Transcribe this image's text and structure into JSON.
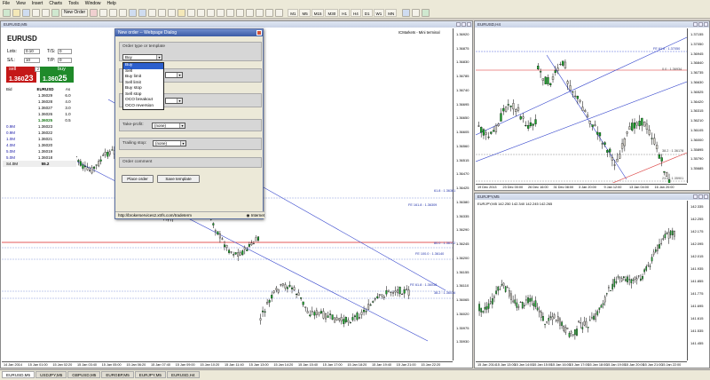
{
  "menu": [
    "File",
    "View",
    "Insert",
    "Charts",
    "Tools",
    "Window",
    "Help"
  ],
  "toolbar": {
    "new_order": "New Order",
    "timeframes": [
      "M1",
      "M5",
      "M15",
      "M30",
      "H1",
      "H4",
      "D1",
      "W1",
      "MN"
    ]
  },
  "main_chart": {
    "title": "EURUSD,M5",
    "indicator_label": "ICMarkets - Mini terminal",
    "price_axis": [
      "1.36920",
      "1.36875",
      "1.36830",
      "1.36785",
      "1.36740",
      "1.36695",
      "1.36650",
      "1.36605",
      "1.36560",
      "1.36515",
      "1.36470",
      "1.36425",
      "1.36380",
      "1.36335",
      "1.36290",
      "1.36245",
      "1.36200",
      "1.36155",
      "1.36110",
      "1.36065",
      "1.36020",
      "1.35975",
      "1.35930"
    ],
    "time_axis": [
      "14 Jan 2014",
      "15 Jan 01:00",
      "15 Jan 02:20",
      "15 Jan 03:40",
      "15 Jan 05:00",
      "15 Jan 06:20",
      "15 Jan 07:40",
      "15 Jan 09:00",
      "15 Jan 10:20",
      "15 Jan 11:40",
      "15 Jan 13:00",
      "15 Jan 14:20",
      "15 Jan 15:40",
      "15 Jan 17:00",
      "15 Jan 18:20",
      "15 Jan 19:40",
      "15 Jan 21:00",
      "15 Jan 22:20"
    ],
    "levels": [
      "61.8 : 1.36361",
      "FE 161.8 : 1.36309",
      "FE 100.0 : 1.36140",
      "80.0 : 1.36172",
      "FE 61.8 : 1.36038",
      "38.2 : 1.36016"
    ],
    "current_price": "1.36023",
    "red_price": "1.36237"
  },
  "trade_panel": {
    "symbol": "EURUSD",
    "lots_label": "Lots:",
    "lots_value": "0.10",
    "ts_label": "T/S:",
    "ts_value": "0",
    "sl_label": "S/L:",
    "sl_value": "10",
    "tp_label": "T/P:",
    "tp_value": "0",
    "sell_label": "sell",
    "buy_label": "buy",
    "sell_price_prefix": "1.360",
    "sell_price_big": "23",
    "buy_price_prefix": "1.360",
    "buy_price_big": "25",
    "spread": "2",
    "ladder_headers": [
      "Bid",
      "EURUSD",
      "As"
    ],
    "ladder": [
      {
        "bid": "",
        "price": "1.36029",
        "ask": "6.0"
      },
      {
        "bid": "",
        "price": "1.36028",
        "ask": "4.0"
      },
      {
        "bid": "",
        "price": "1.36027",
        "ask": "3.0"
      },
      {
        "bid": "",
        "price": "1.36026",
        "ask": "1.0"
      },
      {
        "bid": "",
        "price": "1.36025",
        "ask": "0.5"
      },
      {
        "bid": "0.9M",
        "price": "1.36023",
        "ask": ""
      },
      {
        "bid": "0.9M",
        "price": "1.36022",
        "ask": ""
      },
      {
        "bid": "1.0M",
        "price": "1.36021",
        "ask": ""
      },
      {
        "bid": "4.0M",
        "price": "1.36020",
        "ask": ""
      },
      {
        "bid": "5.0M",
        "price": "1.36019",
        "ask": ""
      },
      {
        "bid": "5.0M",
        "price": "1.36018",
        "ask": ""
      }
    ],
    "total_bid": "S4.0M",
    "total_mid": "55.2"
  },
  "dialog": {
    "title": "New order -- Webpage Dialog",
    "section_type": "Order type or template",
    "selected_type": "Buy",
    "options": [
      "Buy",
      "Sell",
      "Buy limit",
      "Sell limit",
      "Buy stop",
      "Sell stop",
      "OCO breakout",
      "OCO reversion"
    ],
    "take_profit_label": "Take-profit:",
    "take_profit_value": "(none)",
    "trailing_stop_label": "Trailing stop:",
    "trailing_stop_value": "(none)",
    "comment_label": "Order comment",
    "place_order": "Place order",
    "save_template": "Save template",
    "url": "http://brokerservices2.xtrfs.com/tradeterm",
    "zone": "Internet"
  },
  "chart_h4": {
    "title": "EURUSD,H4",
    "price_axis": [
      "1.37155",
      "1.37050",
      "1.36945",
      "1.36840",
      "1.36735",
      "1.36630",
      "1.36525",
      "1.36420",
      "1.36315",
      "1.36210",
      "1.36105",
      "1.36000",
      "1.35895",
      "1.35790",
      "1.35685"
    ],
    "time_axis": [
      "19 Dec 2013",
      "23 Dec 00:00",
      "26 Dec 16:00",
      "31 Dec 08:00",
      "3 Jan 20:00",
      "9 Jan 12:00",
      "13 Jan 04:00",
      "16 Jan 20:00"
    ],
    "levels": [
      "FE 61.8 : 1.37050",
      "0.0 : 1.36934",
      "38.2 : 1.36178",
      "23.6 : 1.35901"
    ],
    "current_price": "1.36023"
  },
  "chart_eurjpy": {
    "title": "EURJPY,M5",
    "ohlc": "142.250 142.340 142.245 142.265",
    "price_axis": [
      "142.335",
      "142.255",
      "142.175",
      "142.095",
      "142.015",
      "141.935",
      "141.855",
      "141.775",
      "141.695",
      "141.615",
      "141.535",
      "141.455"
    ],
    "time_axis": [
      "15 Jan 2014",
      "15 Jan 13:00",
      "15 Jan 14:00",
      "15 Jan 15:00",
      "15 Jan 16:00",
      "15 Jan 17:00",
      "15 Jan 18:00",
      "15 Jan 19:00",
      "15 Jan 20:00",
      "15 Jan 21:00",
      "15 Jan 22:00"
    ]
  },
  "bottom_tabs": [
    "EURUSD,M5",
    "USDJPY,M5",
    "GBPUSD,M5",
    "EURGBP,M5",
    "EURJPY,M5",
    "EURUSD,H4"
  ],
  "colors": {
    "sell": "#c41818",
    "buy": "#1f8a2a",
    "grid_line": "#4455cc",
    "level_red": "#dd2222"
  }
}
